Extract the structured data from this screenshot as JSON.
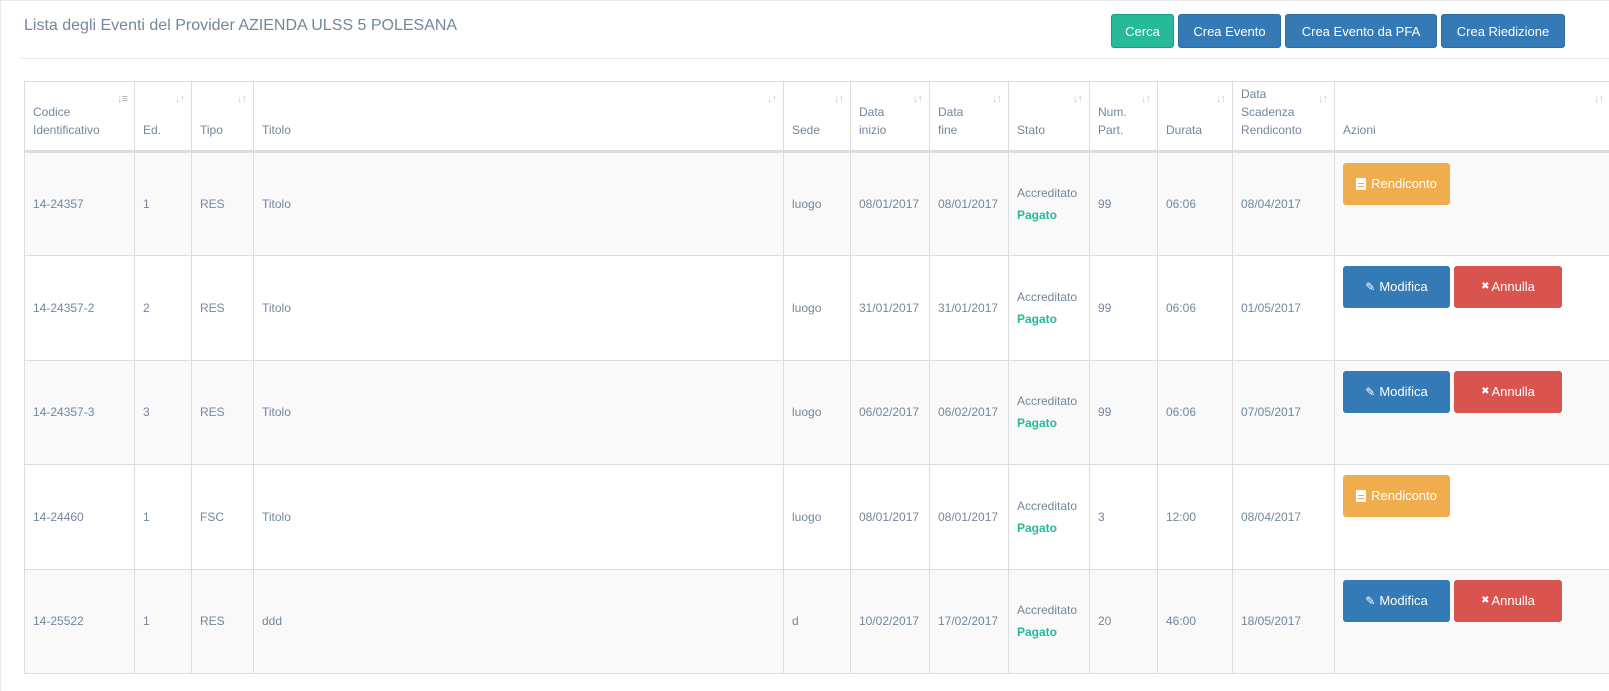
{
  "header": {
    "title": "Lista degli Eventi del Provider AZIENDA ULSS 5 POLESANA",
    "buttons": {
      "cerca": "Cerca",
      "crea_evento": "Crea Evento",
      "crea_evento_pfa": "Crea Evento da PFA",
      "crea_riedizione": "Crea Riedizione"
    }
  },
  "colors": {
    "success": "#26b99a",
    "primary": "#337ab7",
    "warning": "#f0ad4e",
    "danger": "#d9534f"
  },
  "table": {
    "columns": {
      "codice": "Codice Identificativo",
      "ed": "Ed.",
      "tipo": "Tipo",
      "titolo": "Titolo",
      "sede": "Sede",
      "data_inizio": "Data inizio",
      "data_fine": "Data fine",
      "stato": "Stato",
      "num_part": "Num. Part.",
      "durata": "Durata",
      "data_scadenza": "Data Scadenza Rendiconto",
      "azioni": "Azioni"
    },
    "sort_icon": "sort-icon",
    "actions": {
      "rendiconto": "Rendiconto",
      "modifica": "Modifica",
      "annulla": "Annulla"
    },
    "rows": [
      {
        "codice": "14-24357",
        "ed": "1",
        "tipo": "RES",
        "titolo": "Titolo",
        "sede": "luogo",
        "data_inizio": "08/01/2017",
        "data_fine": "08/01/2017",
        "stato": "Accreditato",
        "pagamento": "Pagato",
        "num_part": "99",
        "durata": "06:06",
        "data_scadenza": "08/04/2017",
        "azioni": "rendiconto"
      },
      {
        "codice": "14-24357-2",
        "ed": "2",
        "tipo": "RES",
        "titolo": "Titolo",
        "sede": "luogo",
        "data_inizio": "31/01/2017",
        "data_fine": "31/01/2017",
        "stato": "Accreditato",
        "pagamento": "Pagato",
        "num_part": "99",
        "durata": "06:06",
        "data_scadenza": "01/05/2017",
        "azioni": "modifica-annulla"
      },
      {
        "codice": "14-24357-3",
        "ed": "3",
        "tipo": "RES",
        "titolo": "Titolo",
        "sede": "luogo",
        "data_inizio": "06/02/2017",
        "data_fine": "06/02/2017",
        "stato": "Accreditato",
        "pagamento": "Pagato",
        "num_part": "99",
        "durata": "06:06",
        "data_scadenza": "07/05/2017",
        "azioni": "modifica-annulla"
      },
      {
        "codice": "14-24460",
        "ed": "1",
        "tipo": "FSC",
        "titolo": "Titolo",
        "sede": "luogo",
        "data_inizio": "08/01/2017",
        "data_fine": "08/01/2017",
        "stato": "Accreditato",
        "pagamento": "Pagato",
        "num_part": "3",
        "durata": "12:00",
        "data_scadenza": "08/04/2017",
        "azioni": "rendiconto"
      },
      {
        "codice": "14-25522",
        "ed": "1",
        "tipo": "RES",
        "titolo": "ddd",
        "sede": "d",
        "data_inizio": "10/02/2017",
        "data_fine": "17/02/2017",
        "stato": "Accreditato",
        "pagamento": "Pagato",
        "num_part": "20",
        "durata": "46:00",
        "data_scadenza": "18/05/2017",
        "azioni": "modifica-annulla"
      }
    ]
  }
}
